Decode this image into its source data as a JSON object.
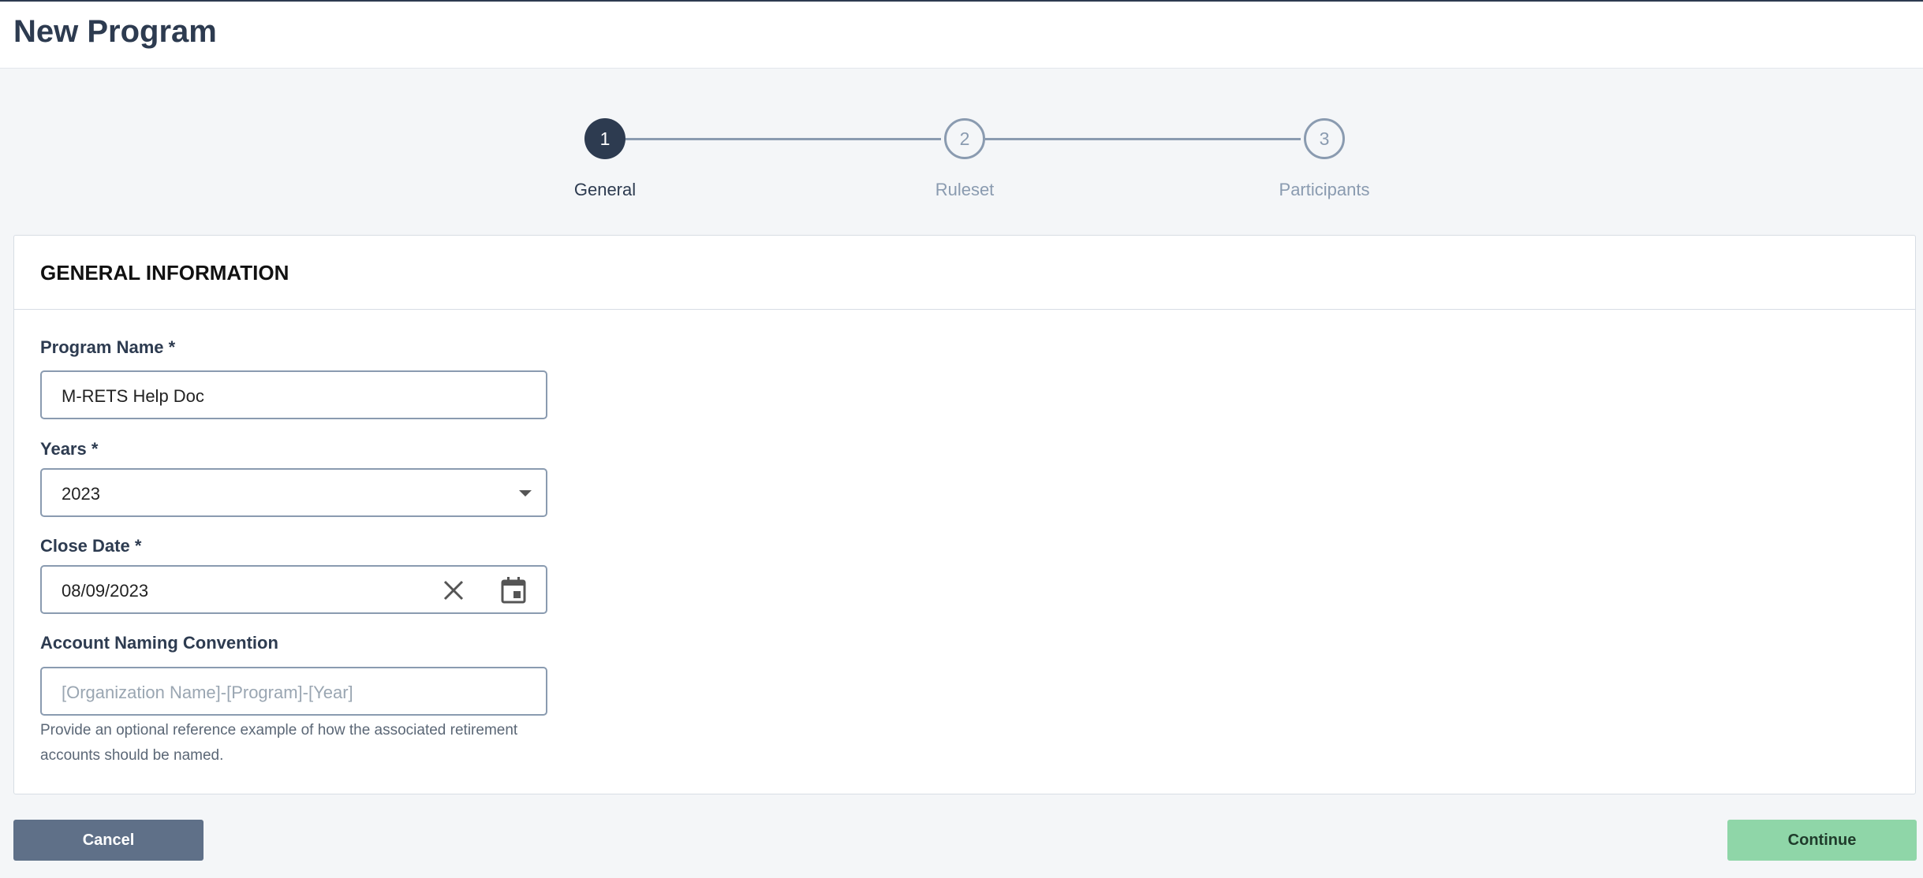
{
  "page": {
    "title": "New Program"
  },
  "stepper": {
    "steps": [
      {
        "number": "1",
        "label": "General",
        "state": "active"
      },
      {
        "number": "2",
        "label": "Ruleset",
        "state": "inactive"
      },
      {
        "number": "3",
        "label": "Participants",
        "state": "inactive"
      }
    ]
  },
  "card": {
    "title": "GENERAL INFORMATION",
    "program_name": {
      "label": "Program Name  *",
      "value": "M-RETS Help Doc"
    },
    "years": {
      "label": "Years  *",
      "value": "2023",
      "icon": "chevron-down-icon"
    },
    "close_date": {
      "label": "Close Date *",
      "value": "08/09/2023",
      "clear_icon": "close-icon",
      "calendar_icon": "calendar-icon"
    },
    "naming": {
      "label": "Account Naming Convention",
      "placeholder": "[Organization Name]-[Program]-[Year]",
      "helper": "Provide an optional reference example of how the associated retirement accounts should be named."
    }
  },
  "actions": {
    "cancel_label": "Cancel",
    "continue_label": "Continue"
  },
  "colors": {
    "primary_dark": "#2d3b50",
    "step_inactive": "#8a9bb0",
    "cancel_bg": "#5f7088",
    "continue_bg": "#8fd6a8"
  }
}
